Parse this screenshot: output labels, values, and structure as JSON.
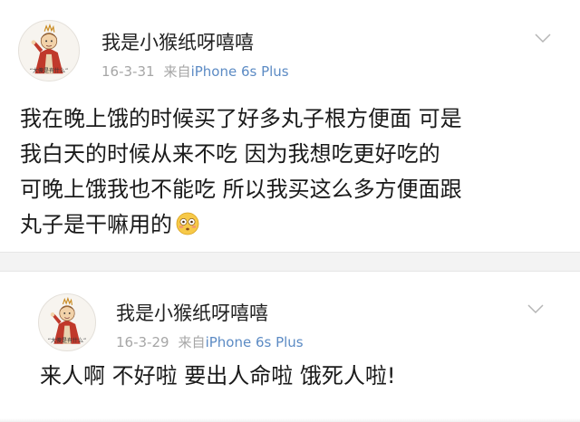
{
  "posts": [
    {
      "username": "我是小猴纸呀嘻嘻",
      "date": "16-3-31",
      "source_prefix": "来自",
      "device": "iPhone 6s Plus",
      "avatar_caption": "“大傻是有什么”",
      "lines": [
        "我在晚上饿的时候买了好多丸子根方便面 可是",
        "我白天的时候从来不吃 因为我想吃更好吃的",
        "可晚上饿我也不能吃 所以我买这么多方便面跟",
        "丸子是干嘛用的"
      ],
      "emoji": "flushed-face-emoji"
    },
    {
      "username": "我是小猴纸呀嘻嘻",
      "date": "16-3-29",
      "source_prefix": "来自",
      "device": "iPhone 6s Plus",
      "avatar_caption": "“大傻是有什么”",
      "lines": [
        "来人啊 不好啦 要出人命啦 饿死人啦!"
      ]
    }
  ],
  "colors": {
    "username": "#222222",
    "meta": "#a6a6a6",
    "device_link": "#5c8bc4",
    "separator": "#f3f3f3"
  },
  "icons": {
    "chevron": "chevron-down-icon",
    "avatar": "avatar-cartoon"
  }
}
